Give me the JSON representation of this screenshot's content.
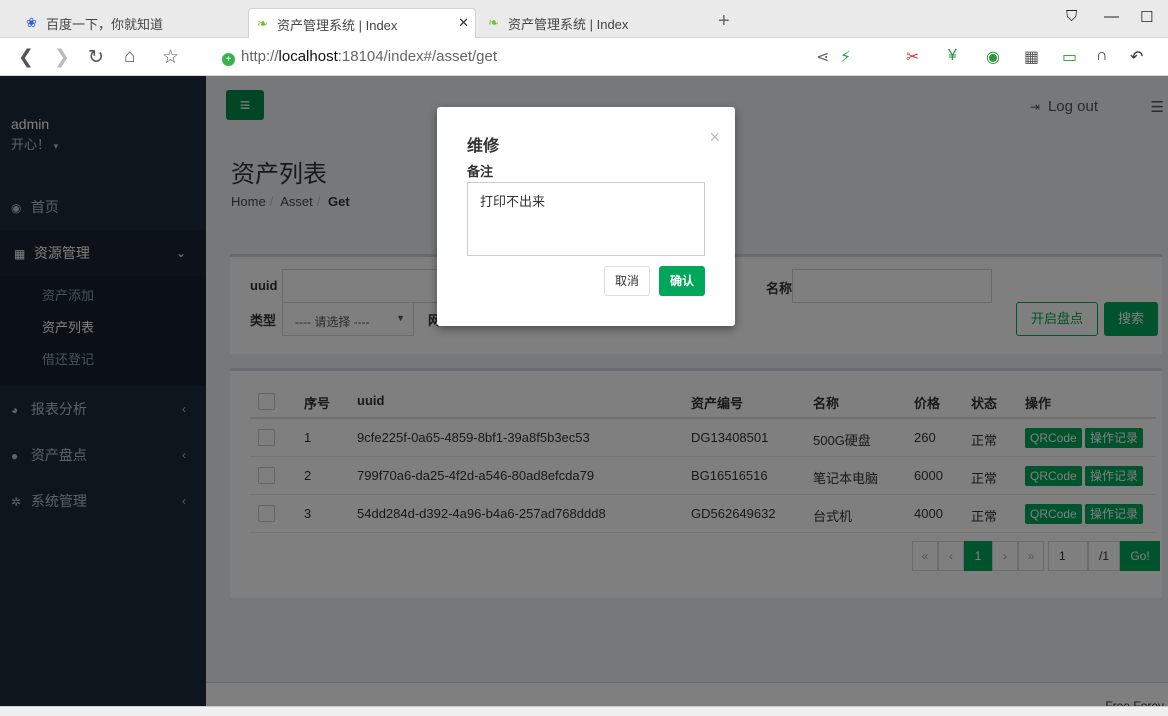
{
  "browser": {
    "tabs": [
      {
        "title": "百度一下，你就知道",
        "active": false
      },
      {
        "title": "资产管理系统 | Index",
        "active": true
      },
      {
        "title": "资产管理系统 | Index",
        "active": false
      }
    ],
    "new_tab": "+",
    "url_prefix": "http://",
    "url_host": "localhost",
    "url_rest": ":18104/index#/asset/get"
  },
  "sidebar": {
    "user_name": "admin",
    "user_status": "开心！",
    "menu": [
      {
        "label": "首页",
        "icon": "dashboard-icon",
        "glyph": "◉"
      },
      {
        "label": "资源管理",
        "icon": "grid-icon",
        "glyph": "▦",
        "open": true,
        "children": [
          "资产添加",
          "资产列表",
          "借还登记"
        ]
      },
      {
        "label": "报表分析",
        "icon": "pie-chart-icon",
        "glyph": "◕"
      },
      {
        "label": "资产盘点",
        "icon": "circle-icon",
        "glyph": "●"
      },
      {
        "label": "系统管理",
        "icon": "cogs-icon",
        "glyph": "✲"
      }
    ]
  },
  "topbar": {
    "logout": "Log out"
  },
  "page": {
    "title": "资产列表",
    "breadcrumb": [
      "Home",
      "Asset",
      "Get"
    ]
  },
  "filters": {
    "uuid_label": "uuid",
    "name_label": "名称",
    "type_label": "类型",
    "type_placeholder": "---- 请选择 ----",
    "partial_label": "网",
    "btn_inventory": "开启盘点",
    "btn_search": "搜索"
  },
  "table": {
    "headers": [
      "序号",
      "uuid",
      "资产编号",
      "名称",
      "价格",
      "状态",
      "操作"
    ],
    "rows": [
      {
        "no": "1",
        "uuid": "9cfe225f-0a65-4859-8bf1-39a8f5b3ec53",
        "code": "DG13408501",
        "name": "500G硬盘",
        "price": "260",
        "status": "正常"
      },
      {
        "no": "2",
        "uuid": "799f70a6-da25-4f2d-a546-80ad8efcda79",
        "code": "BG16516516",
        "name": "笔记本电脑",
        "price": "6000",
        "status": "正常"
      },
      {
        "no": "3",
        "uuid": "54dd284d-d392-4a96-b4a6-257ad768ddd8",
        "code": "GD562649632",
        "name": "台式机",
        "price": "4000",
        "status": "正常"
      }
    ],
    "action_qr": "QRCode",
    "action_log": "操作记录"
  },
  "pager": {
    "first": "«",
    "prev": "‹",
    "current": "1",
    "next": "›",
    "last": "»",
    "page_input": "1",
    "total": "/1",
    "go": "Go!"
  },
  "footer": {
    "text": "Free Forev"
  },
  "modal": {
    "title": "维修",
    "close": "×",
    "label": "备注",
    "text": "打印不出来",
    "cancel": "取消",
    "confirm": "确认"
  },
  "colors": {
    "sidebar_bg": "#1c2a38",
    "accent_green": "#00a65a"
  }
}
